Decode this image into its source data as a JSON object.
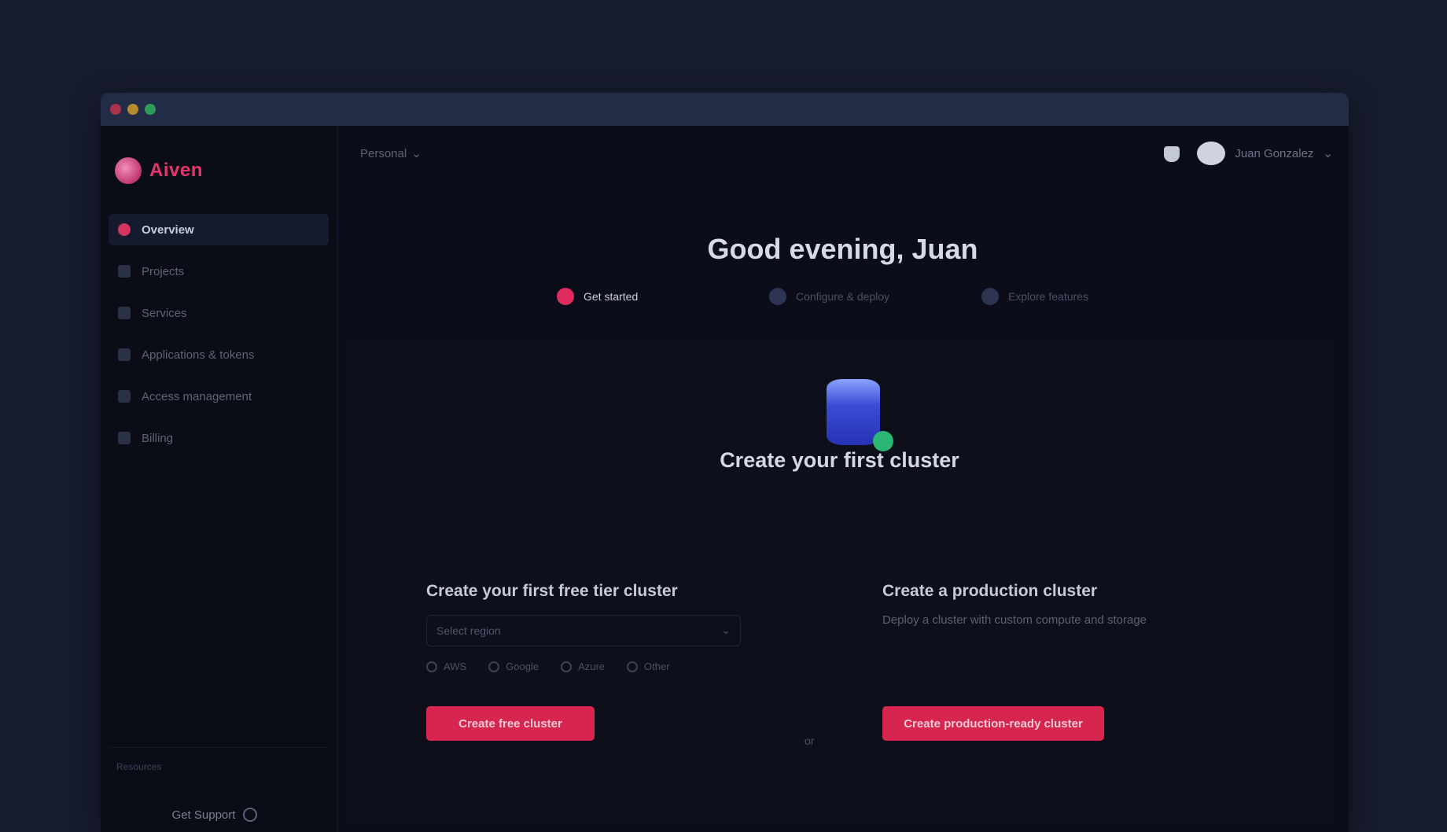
{
  "window": {
    "controls": [
      "close",
      "minimize",
      "maximize"
    ]
  },
  "sidebar": {
    "brand": "Aiven",
    "items": [
      {
        "label": "Overview",
        "icon": "home-icon",
        "active": true
      },
      {
        "label": "Projects",
        "icon": "folder-icon",
        "active": false
      },
      {
        "label": "Services",
        "icon": "server-icon",
        "active": false
      },
      {
        "label": "Applications & tokens",
        "icon": "key-icon",
        "active": false
      },
      {
        "label": "Access management",
        "icon": "users-icon",
        "active": false
      },
      {
        "label": "Billing",
        "icon": "card-icon",
        "active": false
      }
    ],
    "footer_label": "Resources",
    "support_label": "Get Support"
  },
  "topbar": {
    "org_label": "Personal",
    "user_label": "Juan Gonzalez"
  },
  "main": {
    "greeting": "Good evening, Juan",
    "steps": [
      {
        "label": "Get started",
        "active": true
      },
      {
        "label": "Configure & deploy",
        "active": false
      },
      {
        "label": "Explore features",
        "active": false
      }
    ],
    "cluster_title": "Create your first cluster",
    "free_option": {
      "title": "Create your first free tier cluster",
      "region_placeholder": "Select region",
      "providers": [
        "AWS",
        "Google",
        "Azure",
        "Other"
      ],
      "cta": "Create free cluster"
    },
    "or_label": "or",
    "prod_option": {
      "title": "Create a production cluster",
      "description": "Deploy a cluster with custom compute and storage",
      "cta": "Create production-ready cluster"
    }
  },
  "colors": {
    "accent": "#d6264f",
    "background": "#171c2e",
    "panel": "#0b0e18"
  }
}
